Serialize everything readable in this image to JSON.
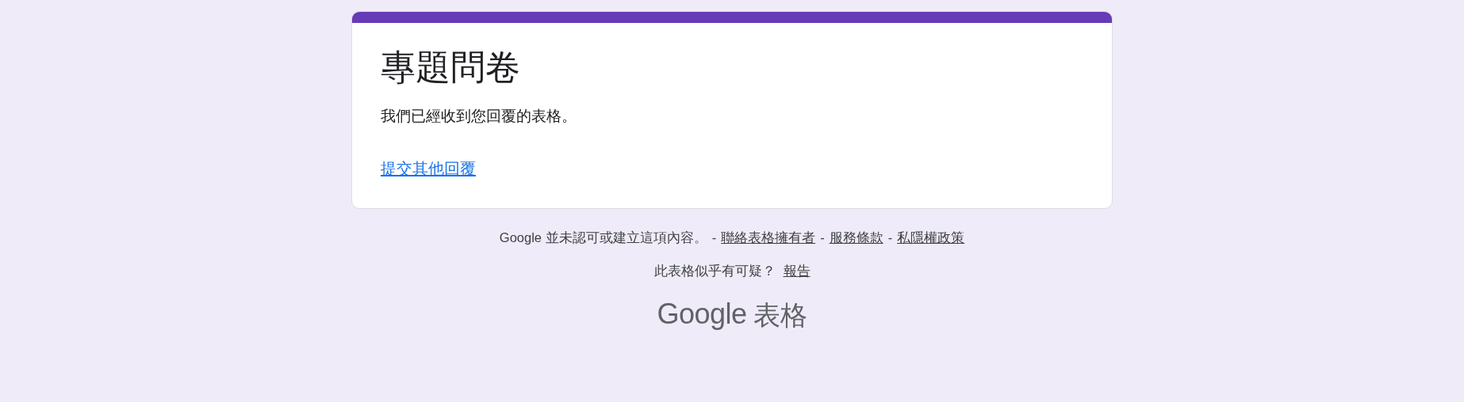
{
  "form": {
    "title": "專題問卷",
    "message": "我們已經收到您回覆的表格。",
    "link": "提交其他回覆"
  },
  "footer": {
    "disclaimer": "Google 並未認可或建立這項內容。",
    "separators": [
      "-",
      "-",
      "-"
    ],
    "links": [
      "聯絡表格擁有者",
      "服務條款",
      "私隱權政策"
    ],
    "suspicious": "此表格似乎有可疑？",
    "report_link": "報告"
  },
  "brand": {
    "name": "Google",
    "product": "表格"
  }
}
